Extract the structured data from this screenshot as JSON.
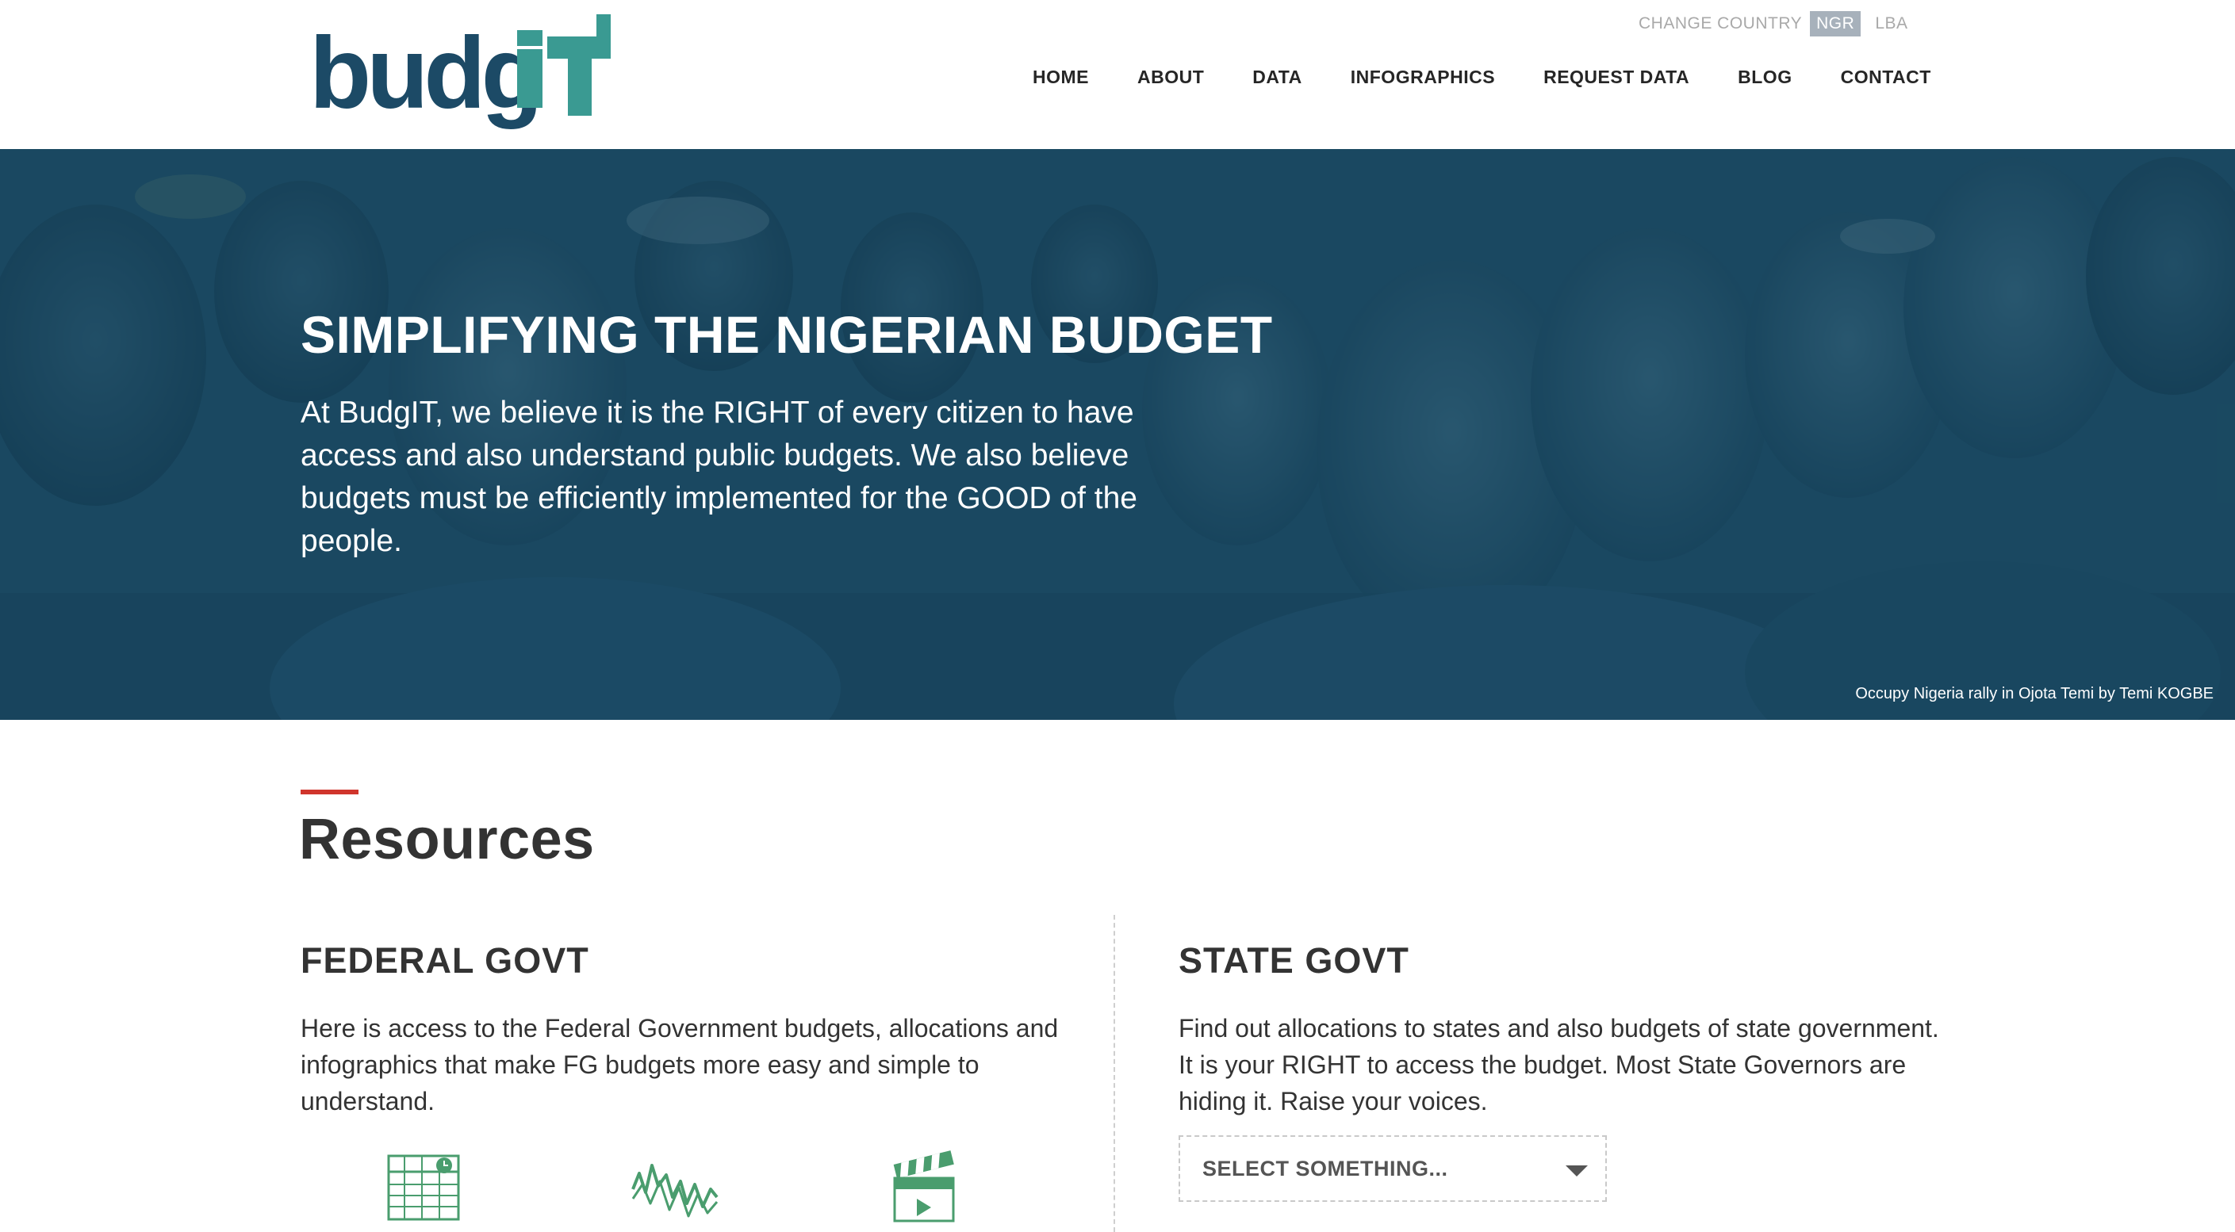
{
  "brand": {
    "logo_text_dark": "budg",
    "logo_text_accent": "IT"
  },
  "country": {
    "label": "CHANGE COUNTRY",
    "options": [
      "NGR",
      "LBA"
    ],
    "selected": "NGR"
  },
  "nav": {
    "items": [
      "HOME",
      "ABOUT",
      "DATA",
      "INFOGRAPHICS",
      "REQUEST DATA",
      "BLOG",
      "CONTACT"
    ]
  },
  "hero": {
    "title": "SIMPLIFYING THE NIGERIAN BUDGET",
    "text": "At BudgIT, we believe it is the RIGHT of every citizen to have access and also understand public budgets. We also believe budgets must be efficiently implemented for the GOOD of the people.",
    "credit_title": "Occupy Nigeria rally in Ojota Temi",
    "credit_by": "by",
    "credit_author": "Temi KOGBE"
  },
  "resources": {
    "title": "Resources",
    "federal": {
      "title": "FEDERAL GOVT",
      "text": "Here is access to the Federal Government budgets, allocations and infographics that make FG budgets more easy and simple to understand."
    },
    "state": {
      "title": "STATE GOVT",
      "text": "Find out allocations to states and also budgets of state government. It is your RIGHT to access the budget. Most State Governors are hiding it. Raise your voices.",
      "select_value": "SELECT SOMETHING..."
    }
  },
  "colors": {
    "brand_dark": "#1c4a66",
    "brand_accent": "#3a9a92",
    "hero_overlay": "#164660",
    "accent_red": "#d0352c",
    "icon_green": "#4a9d6e"
  },
  "icons": [
    "spreadsheet-icon",
    "line-chart-icon",
    "video-icon",
    "caret-down-icon"
  ]
}
